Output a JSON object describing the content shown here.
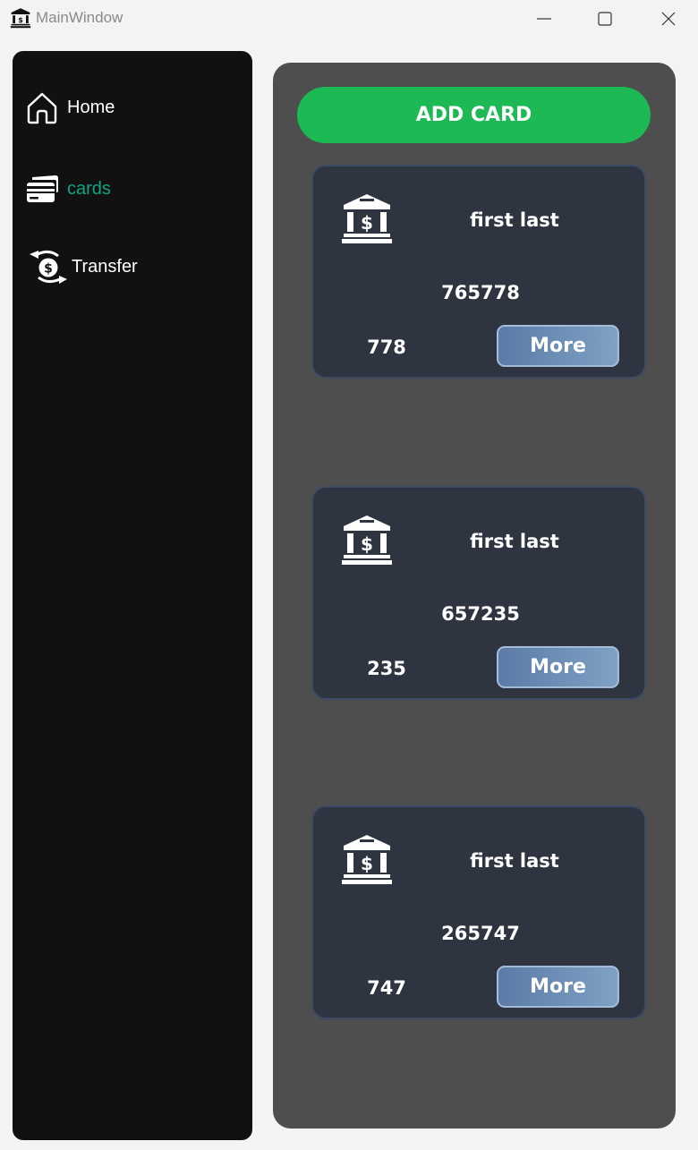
{
  "window": {
    "title": "MainWindow",
    "icons": {
      "app": "bank-icon",
      "minimize": "minimize-icon",
      "maximize": "maximize-icon",
      "close": "close-icon"
    }
  },
  "sidebar": {
    "items": [
      {
        "label": "Home",
        "icon": "home-icon",
        "active": false
      },
      {
        "label": "cards",
        "icon": "credit-cards-icon",
        "active": true
      },
      {
        "label": "Transfer",
        "icon": "money-transfer-icon",
        "active": false
      }
    ],
    "colors": {
      "background": "#111111",
      "active_label": "#14a382",
      "label": "#ffffff"
    }
  },
  "main": {
    "add_card_label": "ADD CARD",
    "cards": [
      {
        "name": "first last",
        "number": "765778",
        "cvv": "778",
        "more_label": "More",
        "icon": "bank-icon"
      },
      {
        "name": "first last",
        "number": "657235",
        "cvv": "235",
        "more_label": "More",
        "icon": "bank-icon"
      },
      {
        "name": "first last",
        "number": "265747",
        "cvv": "747",
        "more_label": "More",
        "icon": "bank-icon"
      }
    ],
    "colors": {
      "panel": "#4e4e4e",
      "add_button": "#1db954",
      "card": "#2f3441",
      "card_border": "#3c4b63"
    }
  }
}
